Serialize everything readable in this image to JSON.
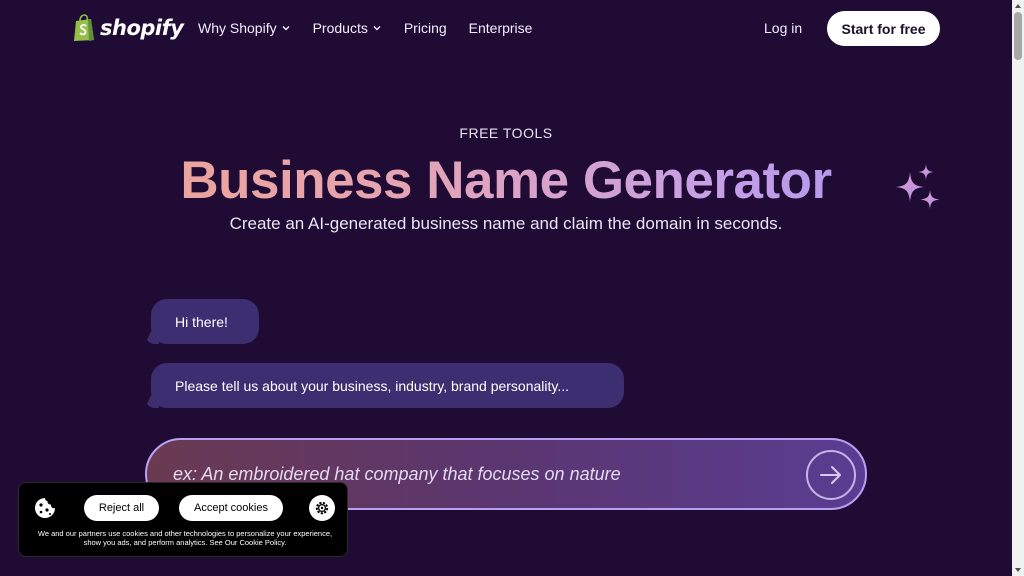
{
  "header": {
    "logo_text": "shopify",
    "nav": [
      {
        "label": "Why Shopify",
        "has_dropdown": true
      },
      {
        "label": "Products",
        "has_dropdown": true
      },
      {
        "label": "Pricing",
        "has_dropdown": false
      },
      {
        "label": "Enterprise",
        "has_dropdown": false
      }
    ],
    "login_label": "Log in",
    "cta_label": "Start for free"
  },
  "hero": {
    "eyebrow": "FREE TOOLS",
    "title": "Business Name Generator",
    "subtitle": "Create an AI-generated business name and claim the domain in seconds."
  },
  "chat": {
    "messages": [
      "Hi there!",
      "Please tell us about your business, industry, brand personality..."
    ],
    "input_placeholder": "ex: An embroidered hat company that focuses on nature"
  },
  "cookie_banner": {
    "reject_label": "Reject all",
    "accept_label": "Accept cookies",
    "text": "We and our partners use cookies and other technologies to personalize your experience, show you ads, and perform analytics. See Our Cookie Policy."
  },
  "colors": {
    "background": "#1f0b33",
    "bubble": "#3c2e70",
    "title_gradient_start": "#f0a48c",
    "title_gradient_end": "#a08ef0",
    "logo_green": "#95bf47"
  }
}
